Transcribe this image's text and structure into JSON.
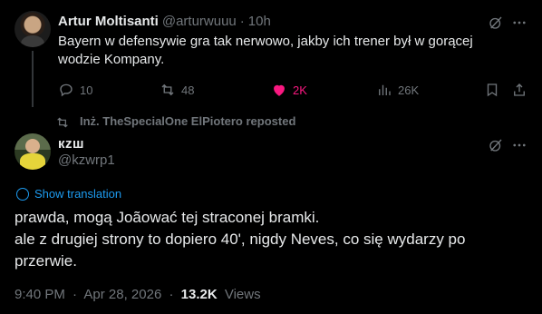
{
  "reply_tweet": {
    "author_name": "Artur Moltisanti",
    "author_handle": "@arturwuuu",
    "separator": "·",
    "time": "10h",
    "text": "Bayern w defensywie gra tak nerwowo, jakby ich trener był w gorącej wodzie Kompany.",
    "replies": "10",
    "reposts": "48",
    "likes": "2K",
    "views": "26K",
    "liked": true,
    "like_color": "#f91880"
  },
  "repost_header": {
    "text": "Inż. TheSpecialOne ElPiotero reposted"
  },
  "main_tweet": {
    "author_name": "кzш",
    "author_handle": "@kzwrp1",
    "show_translation": "Show translation",
    "body_line1": "prawda, mogą Joãować tej straconej bramki.",
    "body_line2": "ale z drugiej strony to dopiero 40', nigdy Neves, co się wydarzy po przerwie.",
    "time": "9:40 PM",
    "date": "Apr 28, 2026",
    "separator": "·",
    "views_count": "13.2K",
    "views_label": "Views"
  },
  "colors": {
    "background": "#000000",
    "text_primary": "#e7e9ea",
    "text_secondary": "#71767b",
    "accent_link": "#1d9bf0"
  },
  "icons": [
    "grok-icon",
    "more-icon",
    "reply-icon",
    "repost-icon",
    "like-icon",
    "views-icon",
    "bookmark-icon",
    "share-icon",
    "globe-icon"
  ]
}
